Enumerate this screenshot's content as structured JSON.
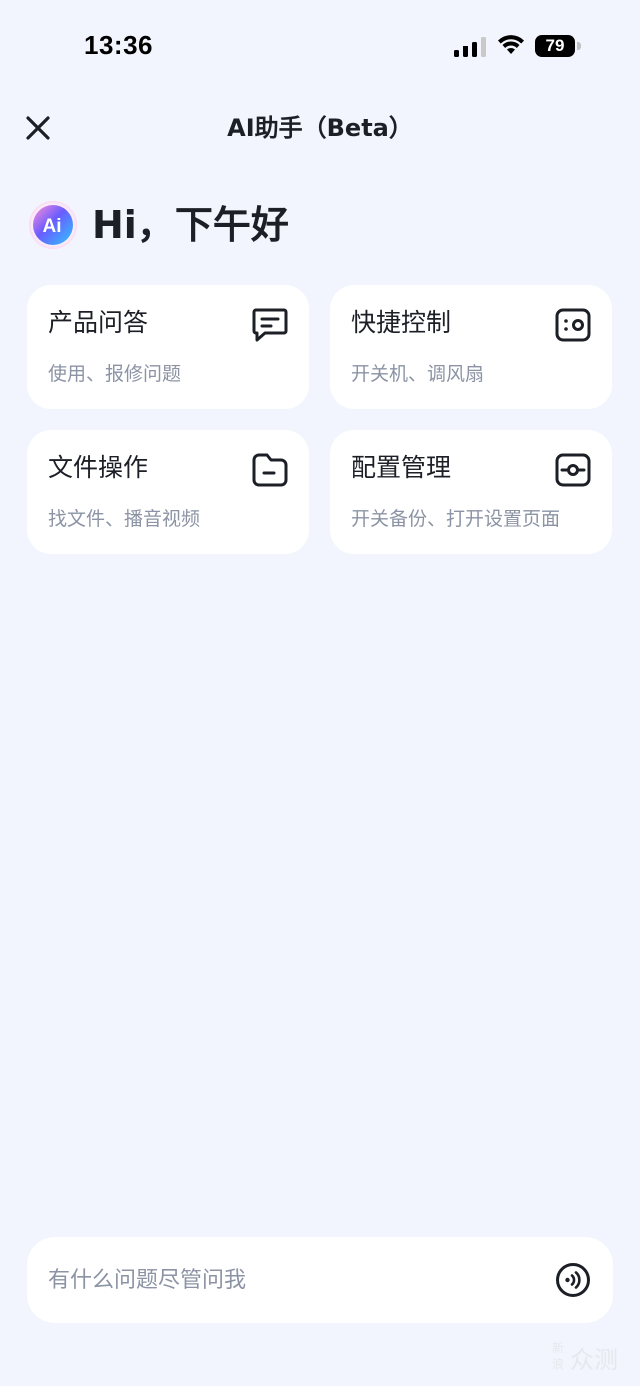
{
  "status_bar": {
    "time": "13:36",
    "battery_level": "79",
    "icons": [
      "signal-icon",
      "wifi-icon",
      "battery-icon"
    ]
  },
  "header": {
    "title": "AI助手（Beta）",
    "close_icon": "close-icon"
  },
  "greeting": {
    "logo_text": "Ai",
    "text": "Hi，下午好"
  },
  "cards": [
    {
      "title": "产品问答",
      "subtitle": "使用、报修问题",
      "icon": "chat-bubble-icon"
    },
    {
      "title": "快捷控制",
      "subtitle": "开关机、调风扇",
      "icon": "remote-control-icon"
    },
    {
      "title": "文件操作",
      "subtitle": "找文件、播音视频",
      "icon": "folder-icon"
    },
    {
      "title": "配置管理",
      "subtitle": "开关备份、打开设置页面",
      "icon": "settings-toggle-icon"
    }
  ],
  "input": {
    "placeholder": "有什么问题尽管问我",
    "value": "",
    "voice_icon": "voice-input-icon"
  },
  "watermark": {
    "small": "新浪",
    "text": "众测"
  },
  "colors": {
    "background": "#f2f5fd",
    "card": "#ffffff",
    "text_primary": "#1c1f26",
    "text_secondary": "#8b93a4",
    "logo_gradient": [
      "#6a5cff",
      "#2fb3ff",
      "#ff7ad9"
    ]
  }
}
